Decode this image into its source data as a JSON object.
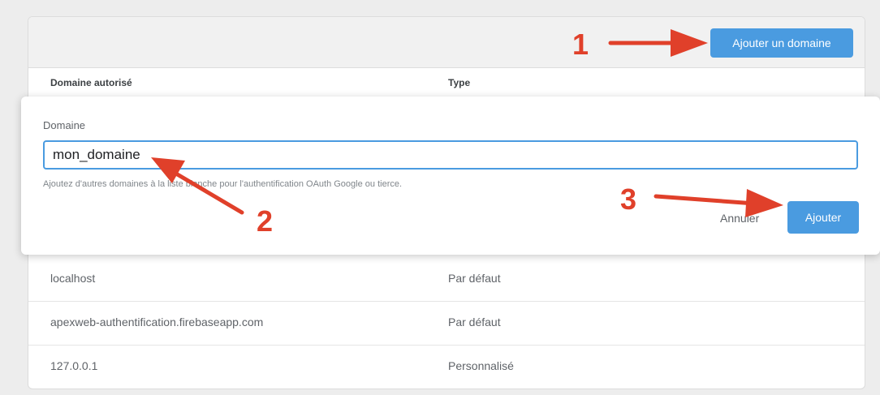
{
  "header": {
    "add_domain_button": "Ajouter un domaine"
  },
  "table": {
    "columns": [
      "Domaine autorisé",
      "Type"
    ],
    "rows": [
      {
        "domain": "localhost",
        "type": "Par défaut"
      },
      {
        "domain": "apexweb-authentification.firebaseapp.com",
        "type": "Par défaut"
      },
      {
        "domain": "127.0.0.1",
        "type": "Personnalisé"
      }
    ]
  },
  "dialog": {
    "field_label": "Domaine",
    "input_value": "mon_domaine",
    "helper_text": "Ajoutez d'autres domaines à la liste blanche pour l'authentification OAuth Google ou tierce.",
    "cancel_label": "Annuler",
    "submit_label": "Ajouter"
  },
  "annotations": {
    "step1": "1",
    "step2": "2",
    "step3": "3"
  },
  "colors": {
    "accent": "#4a9be0",
    "annotation": "#e0402a"
  }
}
